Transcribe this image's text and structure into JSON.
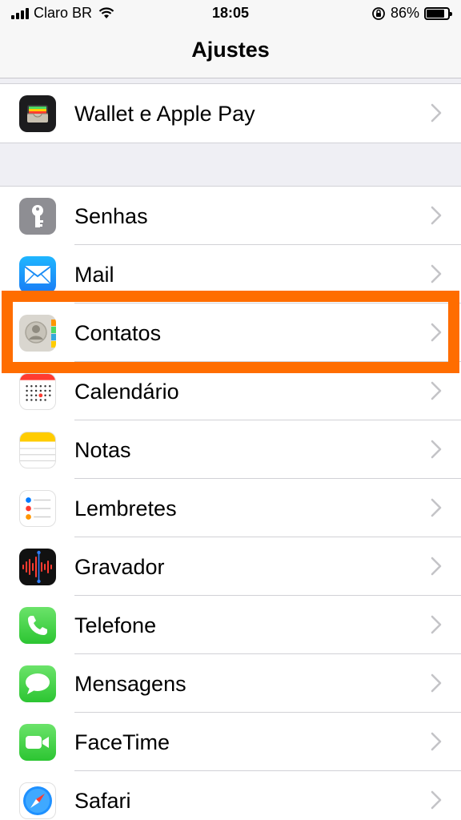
{
  "status_bar": {
    "carrier": "Claro BR",
    "time": "18:05",
    "battery_percent": "86%",
    "battery_level": 0.86
  },
  "nav": {
    "title": "Ajustes"
  },
  "groups": [
    {
      "items": [
        {
          "label": "Wallet e Apple Pay",
          "icon": "wallet-icon"
        }
      ]
    },
    {
      "items": [
        {
          "label": "Senhas",
          "icon": "key-icon"
        },
        {
          "label": "Mail",
          "icon": "mail-icon"
        },
        {
          "label": "Contatos",
          "icon": "contacts-icon"
        },
        {
          "label": "Calendário",
          "icon": "calendar-icon"
        },
        {
          "label": "Notas",
          "icon": "notes-icon"
        },
        {
          "label": "Lembretes",
          "icon": "reminders-icon"
        },
        {
          "label": "Gravador",
          "icon": "voice-memos-icon"
        },
        {
          "label": "Telefone",
          "icon": "phone-icon"
        },
        {
          "label": "Mensagens",
          "icon": "messages-icon"
        },
        {
          "label": "FaceTime",
          "icon": "facetime-icon"
        },
        {
          "label": "Safari",
          "icon": "safari-icon"
        }
      ]
    }
  ],
  "highlighted_item": "Contatos",
  "colors": {
    "highlight": "#ff6d00",
    "background": "#efeff4",
    "chevron": "#c4c4c7"
  }
}
